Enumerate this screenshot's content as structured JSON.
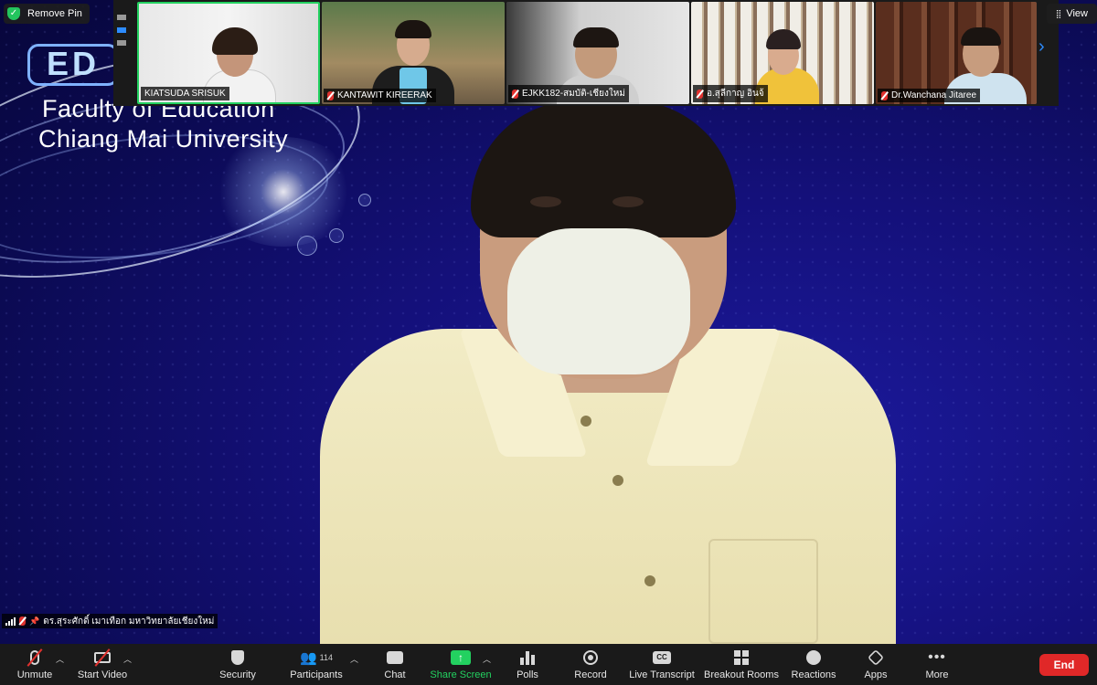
{
  "background": {
    "logo_text": "ED",
    "faculty_line1": "Faculty of Education",
    "faculty_line2": "Chiang Mai University"
  },
  "top_bar": {
    "remove_pin_label": "Remove Pin",
    "view_label": "View"
  },
  "participants_strip": [
    {
      "name": "KIATSUDA SRISUK",
      "muted": false,
      "active": true
    },
    {
      "name": "KANTAWIT KIREERAK",
      "muted": true,
      "active": false
    },
    {
      "name": "EJKK182-สมบัติ-เชียงใหม่",
      "muted": true,
      "active": false
    },
    {
      "name": "อ.สุลีกาญ อินจ้",
      "muted": true,
      "active": false
    },
    {
      "name": "Dr.Wanchana Jitaree",
      "muted": true,
      "active": false
    }
  ],
  "speaker": {
    "name": "ดร.สุระศักดิ์ เมาเทือก มหาวิทยาลัยเชียงใหม่"
  },
  "toolbar": {
    "unmute": "Unmute",
    "start_video": "Start Video",
    "security": "Security",
    "participants": "Participants",
    "participants_count": "114",
    "chat": "Chat",
    "share_screen": "Share Screen",
    "polls": "Polls",
    "record": "Record",
    "live_transcript": "Live Transcript",
    "breakout_rooms": "Breakout Rooms",
    "reactions": "Reactions",
    "apps": "Apps",
    "more": "More",
    "end": "End",
    "cc_icon_text": "CC"
  },
  "colors": {
    "accent": "#2d8cff",
    "share_green": "#23d160",
    "end_red": "#e02828",
    "toolbar_bg": "#1a1a1a"
  }
}
